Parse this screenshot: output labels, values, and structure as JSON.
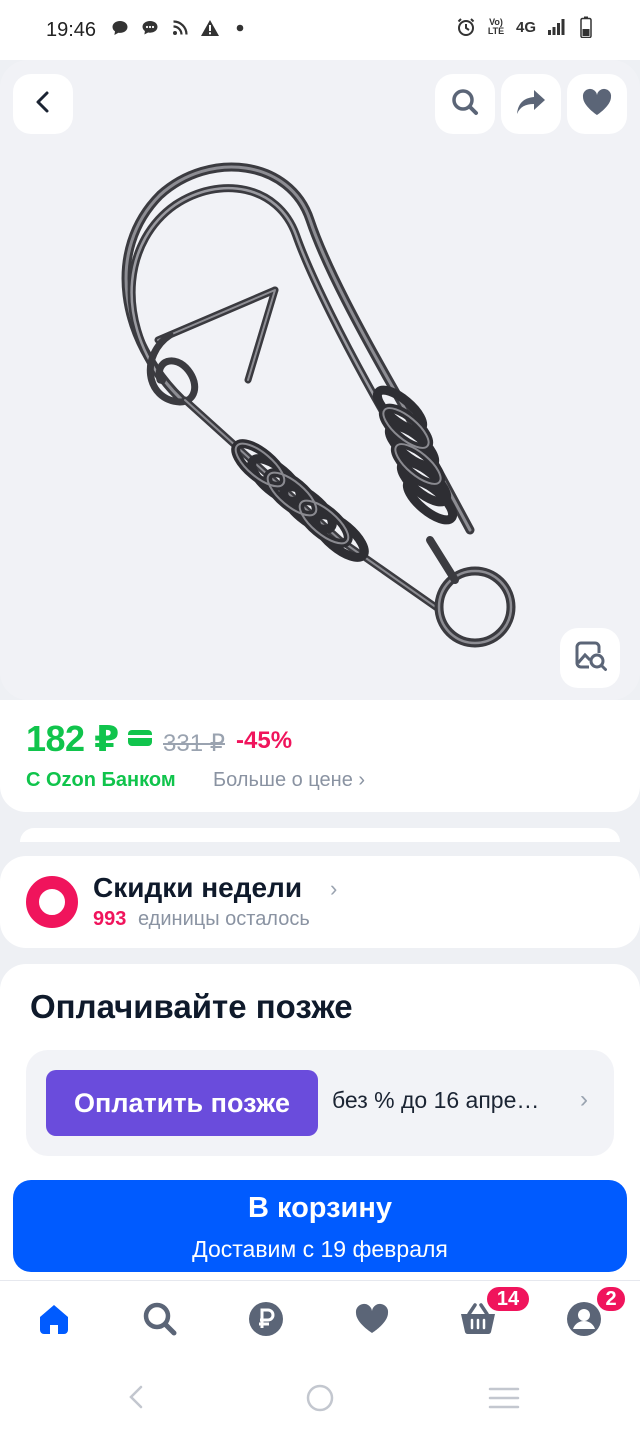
{
  "status_bar": {
    "time": "19:46",
    "left_icons": [
      "chat-icon",
      "chat-bubbles-icon",
      "rss-icon",
      "warning-icon",
      "dot-icon"
    ],
    "right_icons": [
      "alarm-icon",
      "volte-icon",
      "network-4g-icon",
      "signal-icon",
      "battery-icon"
    ],
    "volte": "Vo) LTE",
    "network": "4G"
  },
  "product_image": {
    "subject": "metal snap swivel clip",
    "top_buttons": [
      "back-icon",
      "search-icon",
      "share-icon",
      "heart-icon"
    ],
    "image_search": "image-search-icon"
  },
  "price": {
    "current": "182 ₽",
    "old": "331 ₽",
    "discount": "-45%",
    "bank_label": "С Ozon Банком",
    "more_label": "Больше о цене",
    "more_chevron": "›"
  },
  "deals": {
    "title": "Скидки недели",
    "chevron": "›",
    "count": "993",
    "remaining": "единицы осталось"
  },
  "pay_later": {
    "title": "Оплачивайте позже",
    "button": "Оплатить позже",
    "terms": "без % до 16 апре…",
    "chevron": "›"
  },
  "cart": {
    "label": "В корзину",
    "delivery": "Доставим с 19 февраля"
  },
  "tabbar": {
    "items": [
      {
        "icon": "home-icon",
        "active": true
      },
      {
        "icon": "search-icon"
      },
      {
        "icon": "ruble-icon"
      },
      {
        "icon": "heart-icon"
      },
      {
        "icon": "basket-icon",
        "badge": "14"
      },
      {
        "icon": "profile-icon",
        "badge": "2"
      }
    ]
  },
  "colors": {
    "accent_blue": "#005bff",
    "price_green": "#10c44c",
    "discount_pink": "#f0145c",
    "pay_later_purple": "#6a4cdc"
  }
}
